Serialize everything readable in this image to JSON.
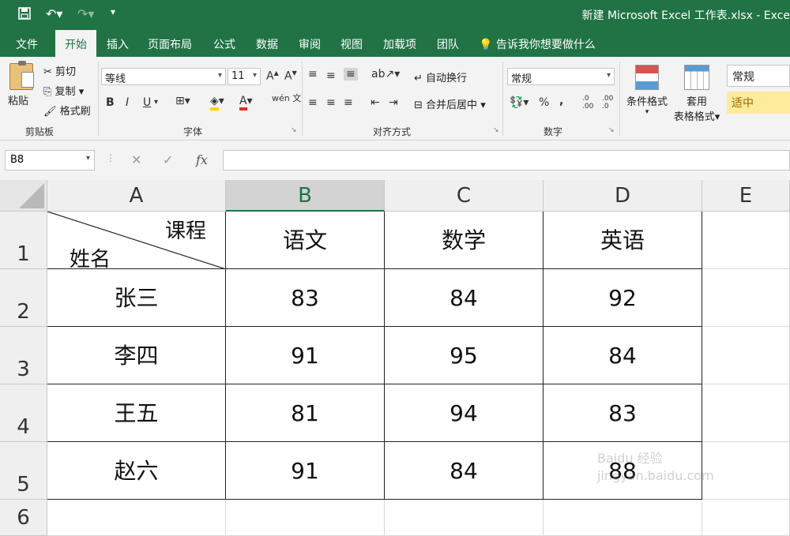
{
  "title": "新建 Microsoft Excel 工作表.xlsx  -  Exce",
  "menu": {
    "items": [
      "文件",
      "开始",
      "插入",
      "页面布局",
      "公式",
      "数据",
      "审阅",
      "视图",
      "加载项",
      "团队"
    ],
    "active": "开始",
    "tell_me": "告诉我你想要做什么"
  },
  "ribbon": {
    "clipboard": {
      "paste": "粘贴",
      "cut": "剪切",
      "copy": "复制",
      "format_painter": "格式刷",
      "label": "剪贴板"
    },
    "font": {
      "name": "等线",
      "size": "11",
      "bold": "B",
      "italic": "I",
      "underline": "U",
      "label": "字体",
      "font_color": "A",
      "phonetic": "wén 文"
    },
    "alignment": {
      "wrap": "自动换行",
      "merge": "合并后居中",
      "label": "对齐方式"
    },
    "number": {
      "format": "常规",
      "percent": "%",
      "comma": ",",
      "inc": ".0 .00",
      "dec": ".00 .0",
      "label": "数字"
    },
    "styles": {
      "conditional": "条件格式",
      "table": "套用",
      "table2": "表格格式",
      "normal": "常规",
      "neutral": "适中"
    }
  },
  "formula_bar": {
    "name_box": "B8",
    "fx": "fx",
    "value": ""
  },
  "sheet": {
    "columns": [
      "A",
      "B",
      "C",
      "D",
      "E"
    ],
    "selected_column": "B",
    "rows": [
      "1",
      "2",
      "3",
      "4",
      "5",
      "6"
    ],
    "header_cell": {
      "top_right": "课程",
      "bottom_left": "姓名"
    },
    "header_row": [
      "语文",
      "数学",
      "英语"
    ],
    "data": [
      {
        "name": "张三",
        "values": [
          "83",
          "84",
          "92"
        ]
      },
      {
        "name": "李四",
        "values": [
          "91",
          "95",
          "84"
        ]
      },
      {
        "name": "王五",
        "values": [
          "81",
          "94",
          "83"
        ]
      },
      {
        "name": "赵六",
        "values": [
          "91",
          "84",
          "88"
        ]
      }
    ]
  },
  "watermark": "Baidu 经验 jingyan.baidu.com",
  "colors": {
    "accent": "#217346",
    "neutral_style": "#ffeb9c"
  }
}
